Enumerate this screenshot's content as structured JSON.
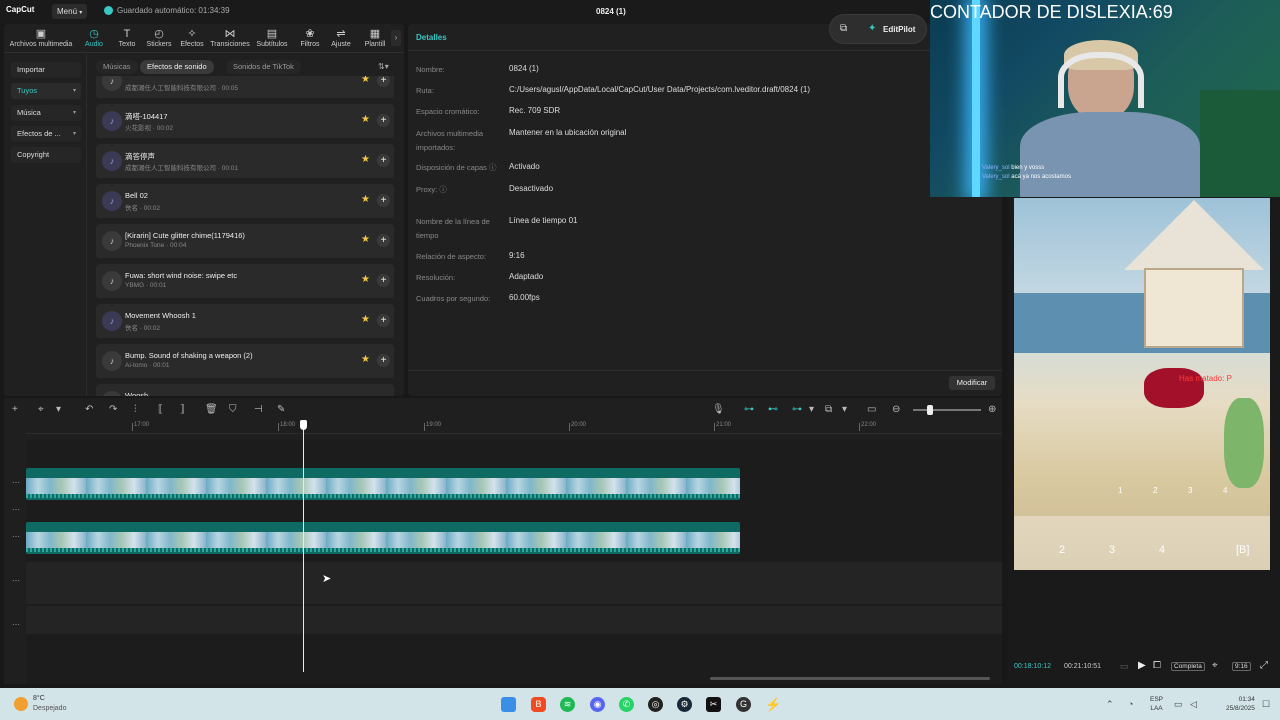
{
  "topbar": {
    "logo": "CapCut",
    "menu": "Menú",
    "autosave": "Guardado automático: 01:34:39",
    "project_title": "0824 (1)"
  },
  "toolbar": [
    {
      "label": "Archivos multimedia",
      "icon": "media-icon"
    },
    {
      "label": "Audio",
      "icon": "audio-icon"
    },
    {
      "label": "Texto",
      "icon": "text-icon"
    },
    {
      "label": "Stickers",
      "icon": "sticker-icon"
    },
    {
      "label": "Efectos",
      "icon": "effects-icon"
    },
    {
      "label": "Transiciones",
      "icon": "transitions-icon"
    },
    {
      "label": "Subtítulos",
      "icon": "subtitles-icon"
    },
    {
      "label": "Filtros",
      "icon": "filters-icon"
    },
    {
      "label": "Ajuste",
      "icon": "adjust-icon"
    },
    {
      "label": "Plantill",
      "icon": "templates-icon"
    }
  ],
  "sidebar": {
    "items": [
      "Importar",
      "Tuyos",
      "Música",
      "Efectos de ...",
      "Copyright"
    ]
  },
  "subtabs": [
    "Músicas",
    "Efectos de sonido",
    "Sonidos de TikTok"
  ],
  "sounds": [
    {
      "title": "",
      "subtitle": "成都潮任人工智能科技有限公司 · 00:05"
    },
    {
      "title": "滴嗒-104417",
      "subtitle": "火花影视 · 00:02"
    },
    {
      "title": "滴答停声",
      "subtitle": "成都潮任人工智能科技有限公司 · 00:01"
    },
    {
      "title": "Bell 02",
      "subtitle": "佚名 · 00:02"
    },
    {
      "title": "[Kirarin] Cute glitter chime(1179416)",
      "subtitle": "Phoenix Tone · 00:04"
    },
    {
      "title": "Fuwa: short wind noise: swipe etc",
      "subtitle": "YBMG · 00:01"
    },
    {
      "title": "Movement Whoosh 1",
      "subtitle": "佚名 · 00:02"
    },
    {
      "title": "Bump. Sound of shaking a weapon (2)",
      "subtitle": "Ai-tomo · 00:01"
    },
    {
      "title": "Woosh",
      "subtitle": ""
    }
  ],
  "details": {
    "header": "Detalles",
    "rows": [
      {
        "label": "Nombre:",
        "value": "0824 (1)"
      },
      {
        "label": "Ruta:",
        "value": "C:/Users/agusl/AppData/Local/CapCut/User Data/Projects/com.lveditor.draft/0824 (1)"
      },
      {
        "label": "Espacio cromático:",
        "value": "Rec. 709 SDR"
      },
      {
        "label": "Archivos multimedia importados:",
        "value": "Mantener en la ubicación original"
      },
      {
        "label": "Disposición de capas ⓘ",
        "value": "Activado"
      },
      {
        "label": "Proxy: ⓘ",
        "value": "Desactivado"
      },
      {
        "label": "Nombre de la línea de tiempo",
        "value": "Línea de tiempo 01"
      },
      {
        "label": "Relación de aspecto:",
        "value": "9:16"
      },
      {
        "label": "Resolución:",
        "value": "Adaptado"
      },
      {
        "label": "Cuadros por segundo:",
        "value": "60.00fps"
      }
    ],
    "modify_button": "Modificar"
  },
  "editpilot": "EditPilot",
  "ruler": [
    "17:00",
    "18:00",
    "19:00",
    "20:00",
    "21:00",
    "22:00"
  ],
  "overlay": {
    "counter": "CONTADOR DE DISLEXIA:69",
    "chat": [
      {
        "user": "Valery_sol",
        "msg": "bien y vosss"
      },
      {
        "user": "Valery_sol",
        "msg": "acá ya nos acostamos"
      }
    ]
  },
  "game": {
    "killfeed": "Has matado: P",
    "slots_top": [
      "1",
      "2",
      "3",
      "4"
    ],
    "slots_bottom": [
      "2",
      "3",
      "4",
      "[B]"
    ]
  },
  "player": {
    "current": "00:18:10:12",
    "total": "00:21:10:51",
    "fit": "Completa",
    "ratio": "9:16"
  },
  "taskbar": {
    "weather_temp": "8°C",
    "weather_desc": "Despejado",
    "lang1": "ESP",
    "lang2": "LAA",
    "time": "01:34",
    "date": "25/8/2025"
  },
  "colors": {
    "accent": "#38c7c3",
    "clip": "#0f6a63",
    "star": "#f5c842"
  }
}
